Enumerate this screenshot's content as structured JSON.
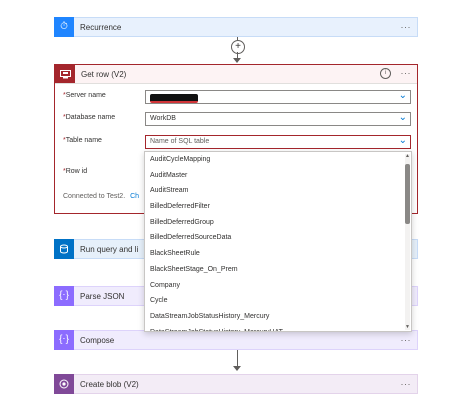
{
  "steps": {
    "recurrence": {
      "title": "Recurrence",
      "more": "···"
    },
    "get_row": {
      "title": "Get row (V2)",
      "more": "···",
      "info": "i",
      "fields": {
        "server_name": {
          "required": "*",
          "label": "Server name",
          "value": ""
        },
        "database_name": {
          "required": "*",
          "label": "Database name",
          "value": "WorkDB"
        },
        "table_name": {
          "required": "*",
          "label": "Table name",
          "placeholder": "Name of SQL table"
        },
        "row_id": {
          "required": "*",
          "label": "Row id"
        }
      },
      "connected_text": "Connected to Test2.",
      "change_link": "Ch"
    },
    "run_query": {
      "title": "Run query and li",
      "more": "···"
    },
    "parse_json": {
      "title": "Parse JSON",
      "more": "···"
    },
    "compose": {
      "title": "Compose",
      "more": "···"
    },
    "create_blob": {
      "title": "Create blob (V2)",
      "more": "···"
    }
  },
  "dropdown": {
    "items": [
      "AuditCycleMapping",
      "AuditMaster",
      "AuditStream",
      "BilledDeferredFilter",
      "BilledDeferredGroup",
      "BilledDeferredSourceData",
      "BlackSheetRule",
      "BlackSheetStage_On_Prem",
      "Company",
      "Cycle",
      "DataStreamJobStatusHistory_Mercury",
      "DataStreamJobStatusHistory_MercuryUAT"
    ]
  },
  "colors": {
    "recurrence": "#1f85ff",
    "get_row": "#a4262c",
    "run_query": "#0072c6",
    "parse_json": "#8c6cff",
    "compose": "#8c6cff",
    "create_blob": "#804998"
  }
}
